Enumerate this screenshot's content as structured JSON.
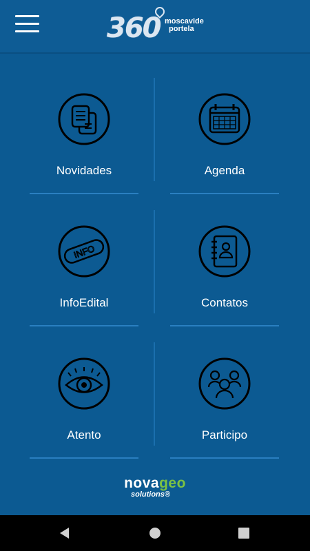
{
  "header": {
    "logo_number": "360",
    "logo_line1": "moscavide",
    "logo_line2": "portela"
  },
  "tiles": [
    {
      "label": "Novidades",
      "icon": "news-icon"
    },
    {
      "label": "Agenda",
      "icon": "calendar-icon"
    },
    {
      "label": "InfoEdital",
      "icon": "info-stamp-icon",
      "icon_text": "INFO"
    },
    {
      "label": "Contatos",
      "icon": "contacts-book-icon"
    },
    {
      "label": "Atento",
      "icon": "eye-icon"
    },
    {
      "label": "Participo",
      "icon": "people-icon"
    }
  ],
  "footer": {
    "brand_part1": "nova",
    "brand_part2": "ge",
    "brand_part3": "o",
    "brand_sub": "solutions®"
  },
  "navbar": {
    "buttons": [
      "back-icon",
      "home-icon",
      "recent-apps-icon"
    ]
  },
  "colors": {
    "background": "#0c5a92",
    "divider": "#2a7fc0",
    "brand_green": "#7cc243",
    "text": "#ffffff"
  }
}
